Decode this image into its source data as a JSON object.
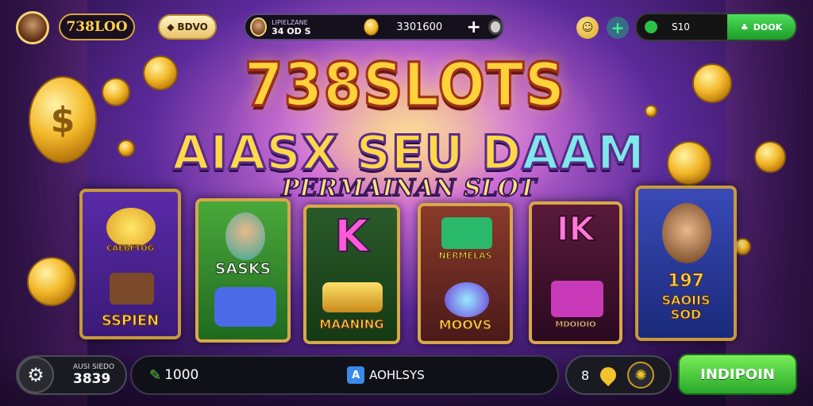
{
  "top": {
    "brand": "738LOO",
    "bdvo_label": "BDVO",
    "player": {
      "line1": "LIPIELZANE",
      "line2": "34 OD S"
    },
    "balance": "3301600",
    "wallet_amount": "S10",
    "wallet_button": "DOOK"
  },
  "title": {
    "main": "738SLOTS",
    "sub_part1": "AIASX SEU D",
    "sub_part2": "AAM",
    "tagline": "PERMAINAN SLOT"
  },
  "cards": [
    {
      "top": "CAEBFTOG",
      "bottom": "SSPIEN"
    },
    {
      "top": "SASKS",
      "bottom": ""
    },
    {
      "top": "K",
      "bottom": "MAANING"
    },
    {
      "top": "NERMELAS",
      "bottom": "MOOVS"
    },
    {
      "top": "IK",
      "bottom": "MDOIOIO"
    },
    {
      "top": "197",
      "bottom": "SAOIIS SOD"
    }
  ],
  "bottom": {
    "bet_label": "AUSI SIEDO",
    "bet_value": "3839",
    "win_value": "1000",
    "auto_label": "AOHLSYS",
    "auto_icon": "A",
    "lines_value": "8",
    "spin_label": "INDIPOIN"
  },
  "icons": [
    "avatar",
    "coin-icon",
    "plus-icon",
    "gear-icon",
    "smile-icon",
    "key-icon",
    "leaf-icon",
    "pin-icon"
  ],
  "colors": {
    "gold": "#ffd23a",
    "green": "#2bc24a",
    "purple": "#5b2a9a"
  }
}
